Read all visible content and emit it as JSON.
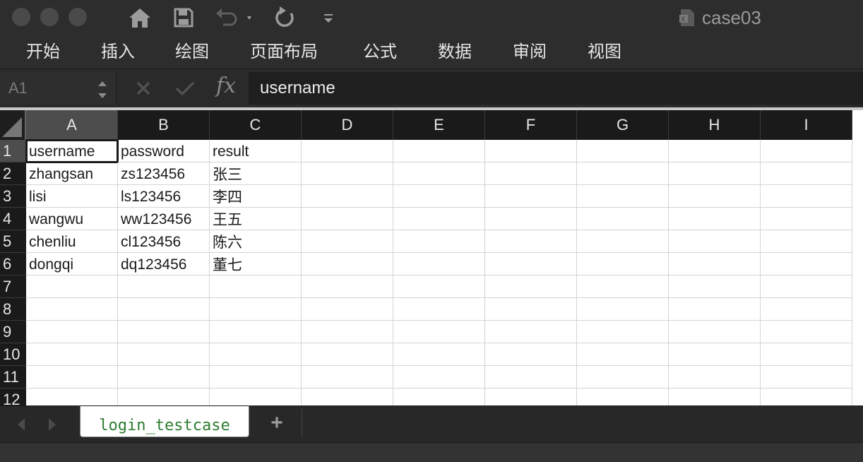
{
  "window": {
    "doc_title": "case03"
  },
  "quick_access": [
    "home-icon",
    "save-icon",
    "undo-icon",
    "redo-icon",
    "customize-icon"
  ],
  "ribbon": {
    "tabs": [
      "开始",
      "插入",
      "绘图",
      "页面布局",
      "公式",
      "数据",
      "审阅",
      "视图"
    ]
  },
  "formula_bar": {
    "name_box": "A1",
    "fx_label": "fx",
    "value": "username"
  },
  "grid": {
    "columns": [
      "A",
      "B",
      "C",
      "D",
      "E",
      "F",
      "G",
      "H",
      "I"
    ],
    "row_numbers": [
      "1",
      "2",
      "3",
      "4",
      "5",
      "6",
      "7",
      "8",
      "9",
      "10",
      "11",
      "12"
    ],
    "rows": [
      [
        "username",
        "password",
        "result"
      ],
      [
        "zhangsan",
        "zs123456",
        "张三"
      ],
      [
        "lisi",
        "ls123456",
        "李四"
      ],
      [
        "wangwu",
        "ww123456",
        "王五"
      ],
      [
        "chenliu",
        "cl123456",
        "陈六"
      ],
      [
        "dongqi",
        "dq123456",
        "董七"
      ]
    ],
    "selected_cell": "A1"
  },
  "sheets": {
    "active": "login_testcase",
    "add_label": "+"
  },
  "colors": {
    "sheet_tab_text": "#2e7d32",
    "header_bg": "#1a1a1a",
    "selected_header_bg": "#4d4d4d"
  }
}
